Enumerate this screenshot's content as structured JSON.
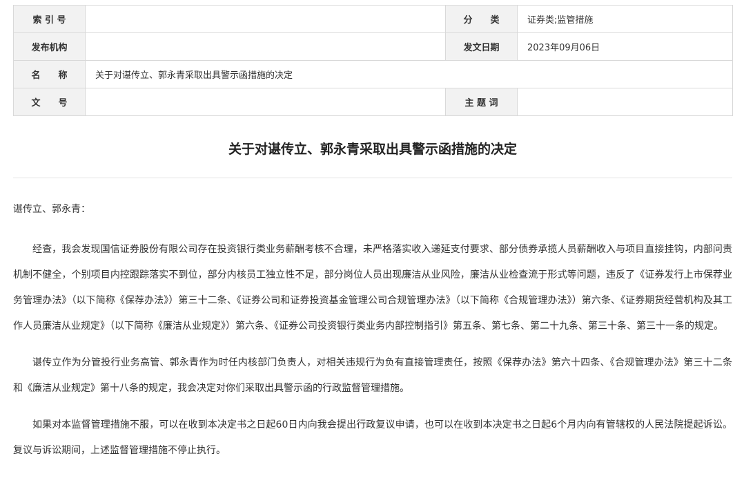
{
  "meta": {
    "index_label": "索 引 号",
    "index_value": "",
    "category_label": "分　　类",
    "category_value": "证券类;监管措施",
    "issuer_label": "发布机构",
    "issuer_value": "",
    "date_label": "发文日期",
    "date_value": "2023年09月06日",
    "name_label": "名　　称",
    "name_value": "关于对谌传立、郭永青采取出具警示函措施的决定",
    "docno_label": "文　　号",
    "docno_value": "",
    "keywords_label": "主 题 词",
    "keywords_value": ""
  },
  "document": {
    "title": "关于对谌传立、郭永青采取出具警示函措施的决定",
    "salutation": "谌传立、郭永青：",
    "paragraphs": [
      "经查，我会发现国信证券股份有限公司存在投资银行类业务薪酬考核不合理，未严格落实收入递延支付要求、部分债券承揽人员薪酬收入与项目直接挂钩，内部问责机制不健全，个别项目内控跟踪落实不到位，部分内核员工独立性不足，部分岗位人员出现廉洁从业风险，廉洁从业检查流于形式等问题，违反了《证券发行上市保荐业务管理办法》（以下简称《保荐办法》）第三十二条、《证券公司和证券投资基金管理公司合规管理办法》（以下简称《合规管理办法》）第六条、《证券期货经营机构及其工作人员廉洁从业规定》（以下简称《廉洁从业规定》）第六条、《证券公司投资银行类业务内部控制指引》第五条、第七条、第二十九条、第三十条、第三十一条的规定。",
      "谌传立作为分管投行业务高管、郭永青作为时任内核部门负责人，对相关违规行为负有直接管理责任，按照《保荐办法》第六十四条、《合规管理办法》第三十二条和《廉洁从业规定》第十八条的规定，我会决定对你们采取出具警示函的行政监督管理措施。",
      "如果对本监督管理措施不服，可以在收到本决定书之日起60日内向我会提出行政复议申请，也可以在收到本决定书之日起6个月内向有管辖权的人民法院提起诉讼。复议与诉讼期间，上述监督管理措施不停止执行。"
    ]
  }
}
